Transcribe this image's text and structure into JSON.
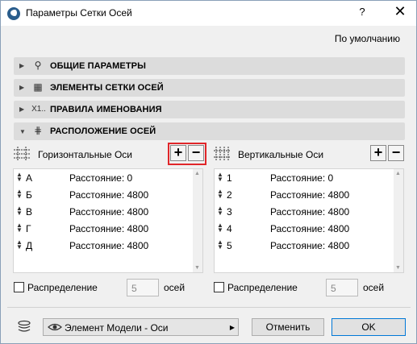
{
  "window": {
    "title": "Параметры Сетки Осей",
    "help_label": "?",
    "close_label": "✕",
    "defaults_label": "По умолчанию"
  },
  "sections": [
    {
      "label": "ОБЩИЕ ПАРАМЕТРЫ",
      "icon": "pin-icon",
      "glyph": "⚲",
      "expanded": false
    },
    {
      "label": "ЭЛЕМЕНТЫ СЕТКИ ОСЕЙ",
      "icon": "grid-elements-icon",
      "glyph": "▦",
      "expanded": false
    },
    {
      "label": "ПРАВИЛА ИМЕНОВАНИЯ",
      "icon": "naming-icon",
      "glyph": "X1..",
      "expanded": false
    },
    {
      "label": "РАСПОЛОЖЕНИЕ ОСЕЙ",
      "icon": "axis-layout-icon",
      "glyph": "⋕",
      "expanded": true
    }
  ],
  "horizontal": {
    "label": "Горизонтальные Оси",
    "add_label": "+",
    "remove_label": "−",
    "rows": [
      {
        "name": "А",
        "distance": "Расстояние: 0"
      },
      {
        "name": "Б",
        "distance": "Расстояние: 4800"
      },
      {
        "name": "В",
        "distance": "Расстояние: 4800"
      },
      {
        "name": "Г",
        "distance": "Расстояние: 4800"
      },
      {
        "name": "Д",
        "distance": "Расстояние: 4800"
      }
    ],
    "distribute_label": "Распределение",
    "count_value": "5",
    "count_unit": "осей"
  },
  "vertical": {
    "label": "Вертикальные Оси",
    "add_label": "+",
    "remove_label": "−",
    "rows": [
      {
        "name": "1",
        "distance": "Расстояние: 0"
      },
      {
        "name": "2",
        "distance": "Расстояние: 4800"
      },
      {
        "name": "3",
        "distance": "Расстояние: 4800"
      },
      {
        "name": "4",
        "distance": "Расстояние: 4800"
      },
      {
        "name": "5",
        "distance": "Расстояние: 4800"
      }
    ],
    "distribute_label": "Распределение",
    "count_value": "5",
    "count_unit": "осей"
  },
  "footer": {
    "layer_label": "Элемент Модели - Оси",
    "cancel_label": "Отменить",
    "ok_label": "OK"
  },
  "colors": {
    "highlight": "#e0262a",
    "section_bg": "#dcdcdc",
    "ok_border": "#0078d7"
  }
}
